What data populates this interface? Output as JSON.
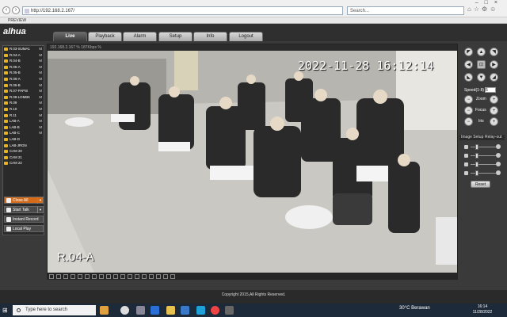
{
  "browser": {
    "url": "http://192.168.2.167/",
    "search_placeholder": "Search...",
    "tab_title": "PREVIEW"
  },
  "app": {
    "logo": "alhua",
    "tabs": [
      "Live",
      "Playback",
      "Alarm",
      "Setup",
      "Info",
      "Logout"
    ],
    "active_tab": "Live"
  },
  "cameras": [
    {
      "name": "R.03-SUMA1",
      "flag": "M"
    },
    {
      "name": "R.04-A",
      "flag": "M"
    },
    {
      "name": "R.04-B",
      "flag": "M"
    },
    {
      "name": "R.05-A",
      "flag": "M"
    },
    {
      "name": "R.05-B",
      "flag": "M"
    },
    {
      "name": "R.06-A",
      "flag": "M"
    },
    {
      "name": "R.06-B",
      "flag": "M"
    },
    {
      "name": "R.07-PAPSI",
      "flag": "M"
    },
    {
      "name": "R.08-LOMBK",
      "flag": "M"
    },
    {
      "name": "R.09",
      "flag": "M"
    },
    {
      "name": "R.10",
      "flag": "M"
    },
    {
      "name": "R.11",
      "flag": "M"
    },
    {
      "name": "LAB-A",
      "flag": "M"
    },
    {
      "name": "LAB-B",
      "flag": "M"
    },
    {
      "name": "LAB-C",
      "flag": "M"
    },
    {
      "name": "LAB-D",
      "flag": ""
    },
    {
      "name": "LAB-JRGN",
      "flag": ""
    },
    {
      "name": "CAM 20",
      "flag": ""
    },
    {
      "name": "CAM 21",
      "flag": ""
    },
    {
      "name": "CAM 22",
      "flag": ""
    }
  ],
  "controls": {
    "close_all": "Close All",
    "start_talk": "Start Talk",
    "instant_record": "Instant Record",
    "local_play": "Local Play"
  },
  "video": {
    "stream_info": "192.168.2.167 % 187Kbps %",
    "timestamp": "2022-11-28 16:12:14",
    "room_label": "R.04-A"
  },
  "ptz": {
    "speed_label": "Speed(1-8)",
    "speed_value": "5",
    "zoom_label": "Zoom",
    "focus_label": "Focus",
    "iris_label": "Iris"
  },
  "image_setup": {
    "header": "Image Setup",
    "relay_out": "Relay-out",
    "reset": "Reset",
    "sliders": [
      0.2,
      0.2,
      0.2,
      0.2
    ]
  },
  "footer": {
    "copyright": "Copyright 2015,All Rights Reserved."
  },
  "taskbar": {
    "search_placeholder": "Type here to search",
    "weather": "30°C  Berawan",
    "time": "16:14",
    "date": "11/28/2022"
  }
}
